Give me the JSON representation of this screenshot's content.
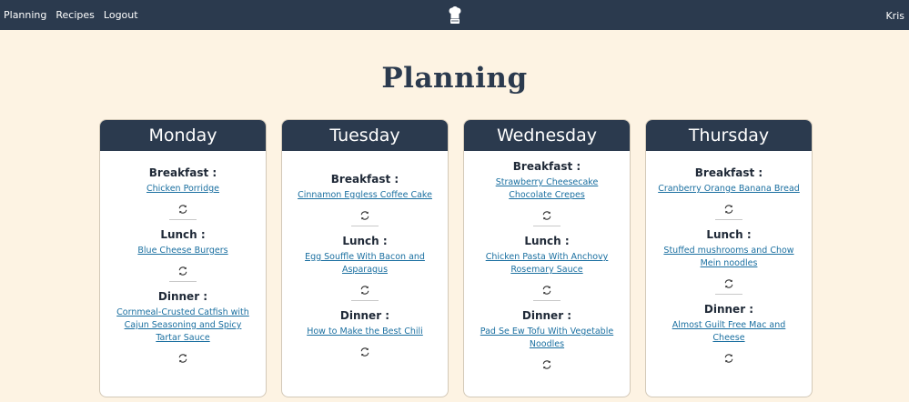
{
  "nav": {
    "items": [
      "Planning",
      "Recipes",
      "Logout"
    ],
    "user": "Kris",
    "logo_icon": "chef-hat-icon"
  },
  "page": {
    "title": "Planning"
  },
  "days": [
    {
      "name": "Monday",
      "meals": [
        {
          "label": "Breakfast :",
          "recipe": "Chicken Porridge"
        },
        {
          "label": "Lunch :",
          "recipe": "Blue Cheese Burgers"
        },
        {
          "label": "Dinner :",
          "recipe": "Cornmeal-Crusted Catfish with Cajun Seasoning and Spicy Tartar Sauce"
        }
      ]
    },
    {
      "name": "Tuesday",
      "meals": [
        {
          "label": "Breakfast :",
          "recipe": "Cinnamon Eggless Coffee Cake"
        },
        {
          "label": "Lunch :",
          "recipe": "Egg Souffle With Bacon and Asparagus"
        },
        {
          "label": "Dinner :",
          "recipe": "How to Make the Best Chili"
        }
      ]
    },
    {
      "name": "Wednesday",
      "meals": [
        {
          "label": "Breakfast :",
          "recipe": "Strawberry Cheesecake Chocolate Crepes"
        },
        {
          "label": "Lunch :",
          "recipe": "Chicken Pasta With Anchovy Rosemary Sauce"
        },
        {
          "label": "Dinner :",
          "recipe": "Pad Se Ew Tofu With Vegetable Noodles"
        }
      ]
    },
    {
      "name": "Thursday",
      "meals": [
        {
          "label": "Breakfast :",
          "recipe": "Cranberry Orange Banana Bread"
        },
        {
          "label": "Lunch :",
          "recipe": "Stuffed mushrooms and Chow Mein noodles"
        },
        {
          "label": "Dinner :",
          "recipe": "Almost Guilt Free Mac and Cheese"
        }
      ]
    }
  ],
  "icons": {
    "refresh": "refresh-icon"
  },
  "colors": {
    "navy": "#2b3a4e",
    "background": "#fdf3e3",
    "link": "#1a6fa0"
  }
}
